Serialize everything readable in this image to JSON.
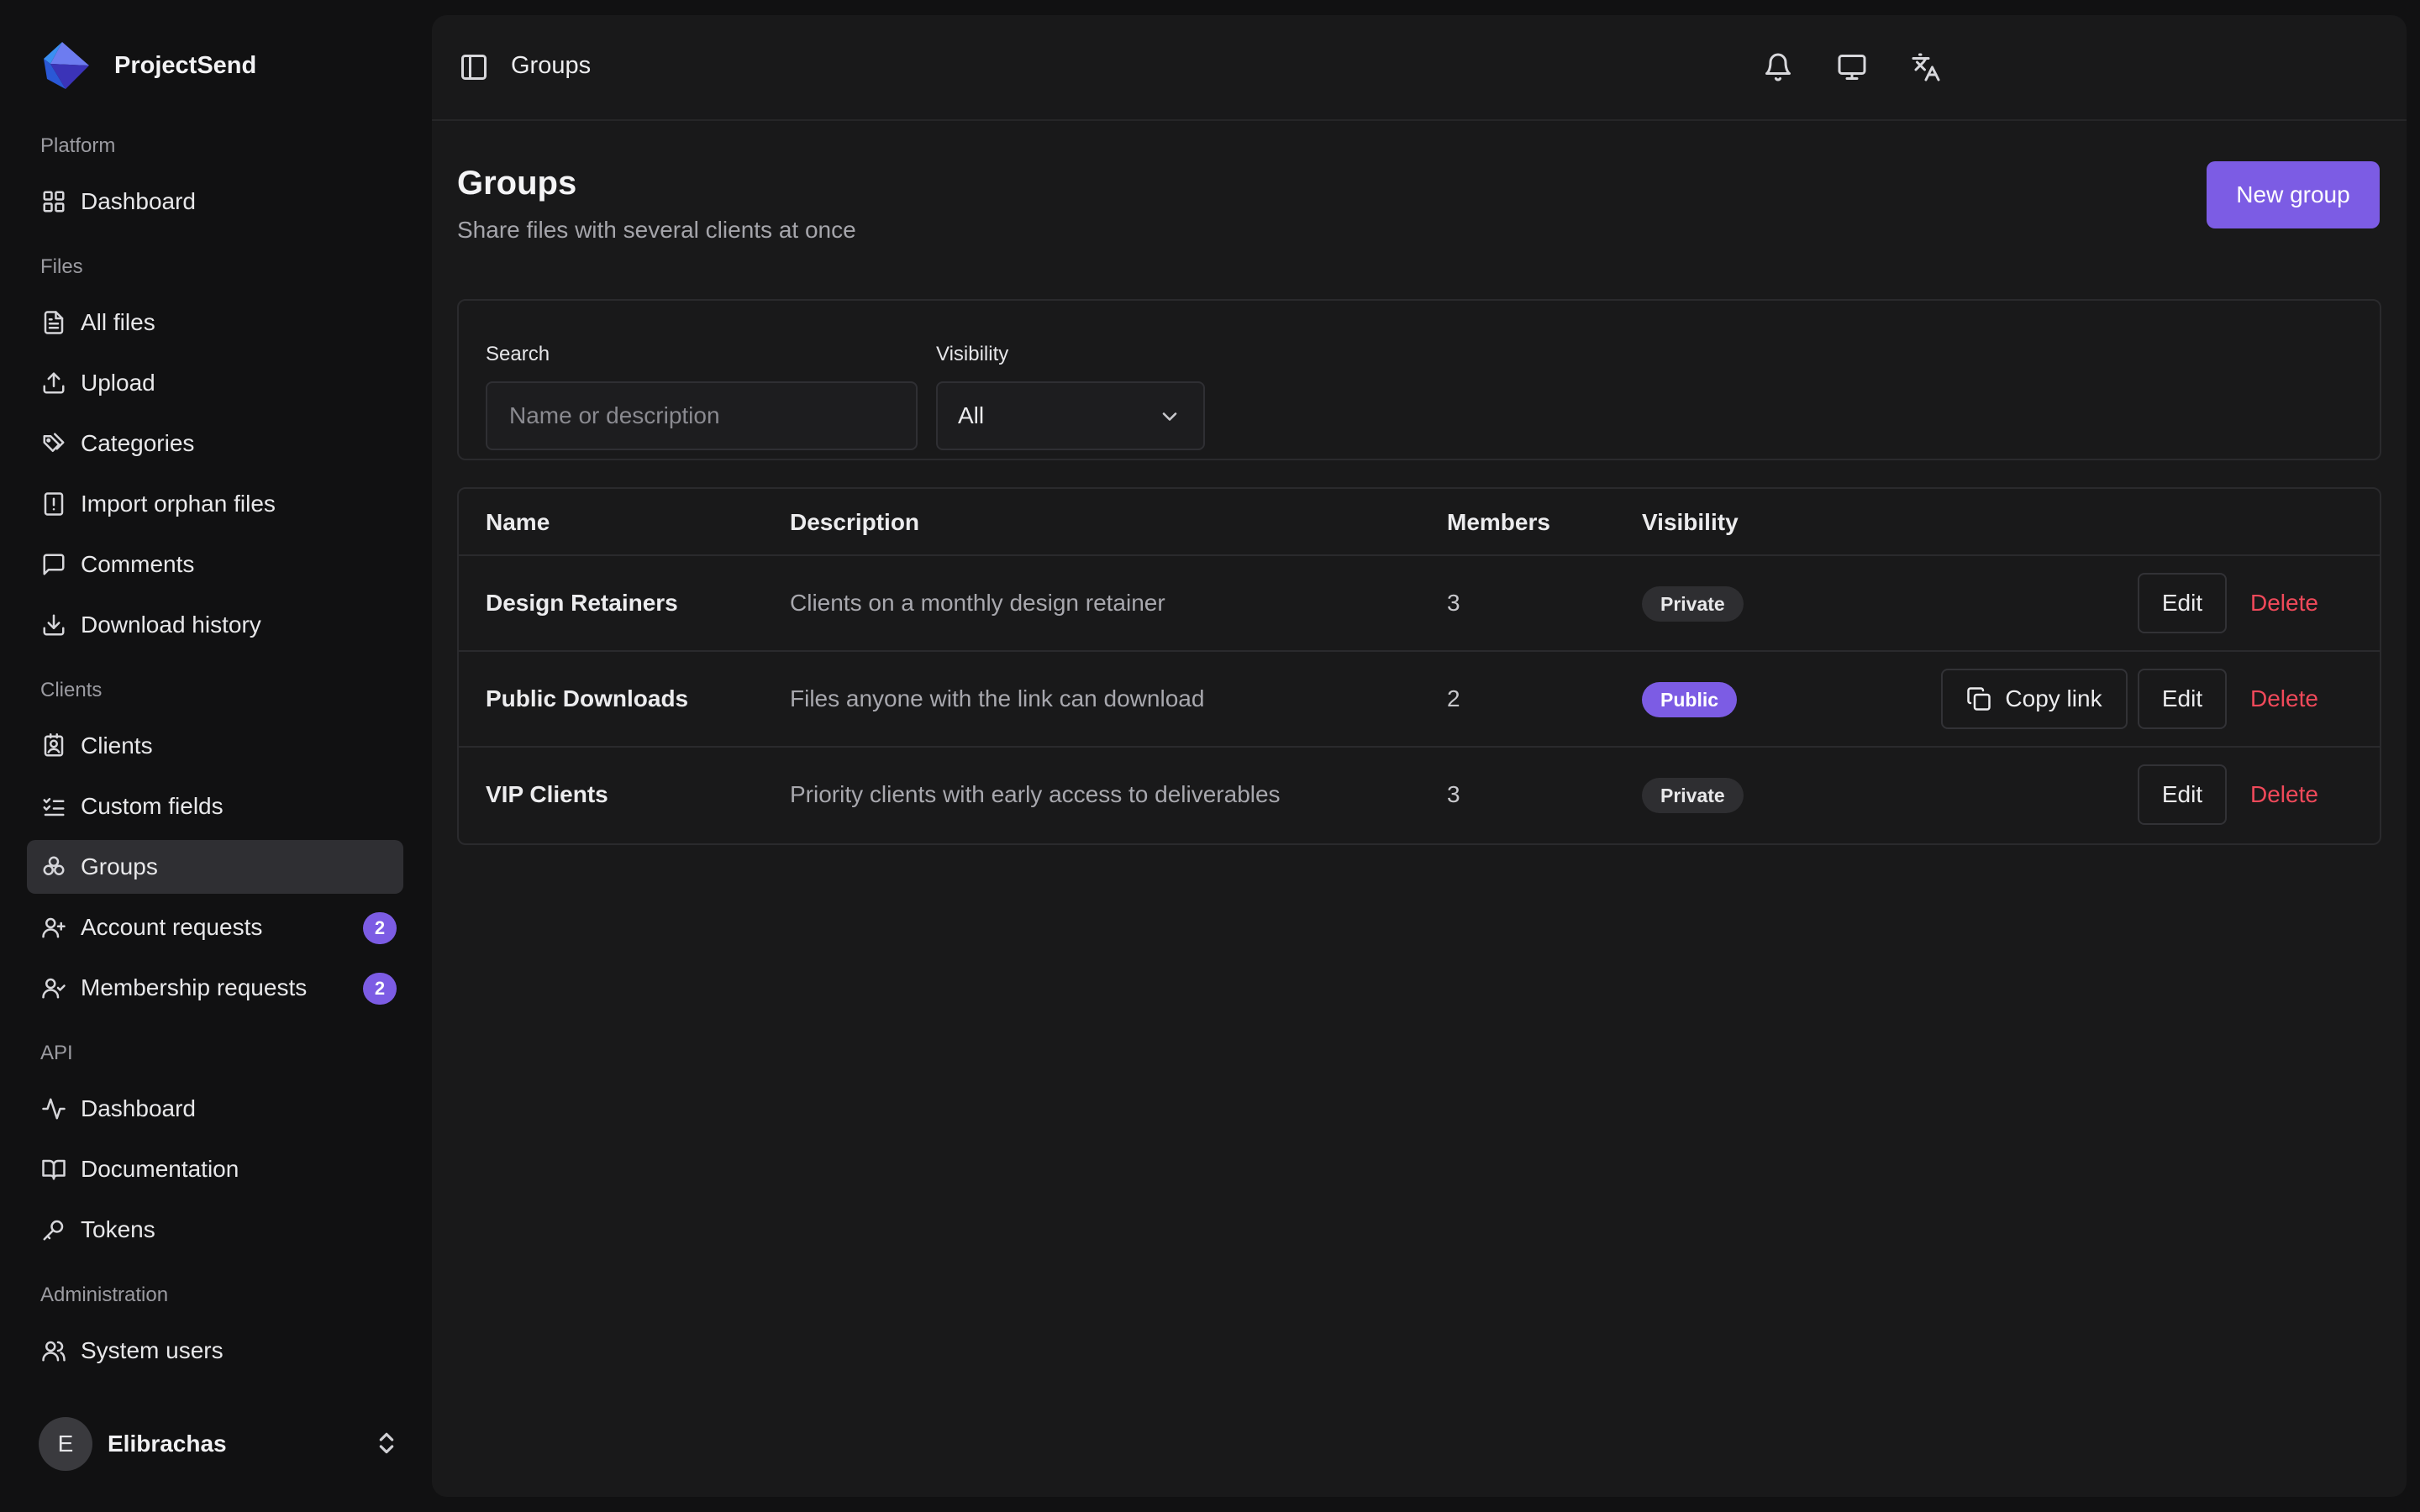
{
  "colors": {
    "accent": "#7c5ce4",
    "danger": "#f0495a",
    "background": "#111112",
    "panel": "#19191a"
  },
  "brand": {
    "name": "ProjectSend"
  },
  "sidebar": {
    "sections": {
      "platform": "Platform",
      "files": "Files",
      "clients": "Clients",
      "api": "API",
      "administration": "Administration"
    },
    "items": {
      "dashboard": {
        "label": "Dashboard",
        "icon": "dashboard-icon"
      },
      "all_files": {
        "label": "All files",
        "icon": "file-icon"
      },
      "upload": {
        "label": "Upload",
        "icon": "upload-icon"
      },
      "categories": {
        "label": "Categories",
        "icon": "tags-icon"
      },
      "import_orphan": {
        "label": "Import orphan files",
        "icon": "file-alert-icon"
      },
      "comments": {
        "label": "Comments",
        "icon": "comment-icon"
      },
      "download_history": {
        "label": "Download history",
        "icon": "download-icon"
      },
      "clients": {
        "label": "Clients",
        "icon": "contact-icon"
      },
      "custom_fields": {
        "label": "Custom fields",
        "icon": "list-check-icon"
      },
      "groups": {
        "label": "Groups",
        "icon": "groups-icon",
        "active": true
      },
      "account_requests": {
        "label": "Account requests",
        "icon": "user-plus-icon",
        "badge": "2"
      },
      "membership_requests": {
        "label": "Membership requests",
        "icon": "user-check-icon",
        "badge": "2"
      },
      "api_dashboard": {
        "label": "Dashboard",
        "icon": "activity-icon"
      },
      "documentation": {
        "label": "Documentation",
        "icon": "book-icon"
      },
      "tokens": {
        "label": "Tokens",
        "icon": "key-icon"
      },
      "system_users": {
        "label": "System users",
        "icon": "users-icon"
      }
    },
    "user": {
      "initial": "E",
      "name": "Elibrachas"
    }
  },
  "topbar": {
    "breadcrumb": "Groups",
    "icons": [
      "sidebar-toggle-icon",
      "bell-icon",
      "monitor-icon",
      "translate-icon"
    ]
  },
  "page": {
    "title": "Groups",
    "subtitle": "Share files with several clients at once",
    "new_button": "New group"
  },
  "filters": {
    "search_label": "Search",
    "search_placeholder": "Name or description",
    "search_value": "",
    "visibility_label": "Visibility",
    "visibility_value": "All"
  },
  "table": {
    "headers": {
      "name": "Name",
      "description": "Description",
      "members": "Members",
      "visibility": "Visibility"
    },
    "rows": [
      {
        "name": "Design Retainers",
        "description": "Clients on a monthly design retainer",
        "members": "3",
        "visibility": "Private",
        "actions": {
          "edit": "Edit",
          "delete": "Delete"
        }
      },
      {
        "name": "Public Downloads",
        "description": "Files anyone with the link can download",
        "members": "2",
        "visibility": "Public",
        "actions": {
          "copy": "Copy link",
          "edit": "Edit",
          "delete": "Delete"
        }
      },
      {
        "name": "VIP Clients",
        "description": "Priority clients with early access to deliverables",
        "members": "3",
        "visibility": "Private",
        "actions": {
          "edit": "Edit",
          "delete": "Delete"
        }
      }
    ]
  }
}
